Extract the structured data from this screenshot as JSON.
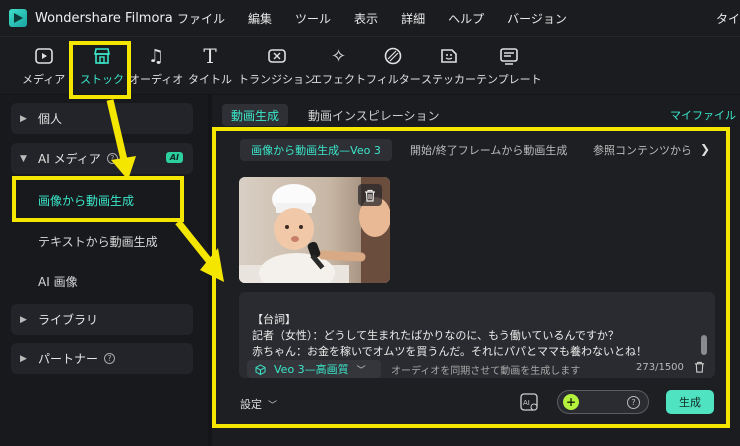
{
  "app": {
    "name": "Wondershare Filmora"
  },
  "menu": [
    "ファイル",
    "編集",
    "ツール",
    "表示",
    "詳細",
    "ヘルプ",
    "バージョン"
  ],
  "title_right_cut": "タイ",
  "toolbar": [
    {
      "label": "メディア",
      "icon": "media-icon"
    },
    {
      "label": "ストック",
      "icon": "stock-icon"
    },
    {
      "label": "オーディオ",
      "icon": "audio-icon"
    },
    {
      "label": "タイトル",
      "icon": "title-icon"
    },
    {
      "label": "トランジション",
      "icon": "transition-icon"
    },
    {
      "label": "エフェクト",
      "icon": "effect-icon"
    },
    {
      "label": "フィルター",
      "icon": "filter-icon"
    },
    {
      "label": "ステッカー",
      "icon": "sticker-icon"
    },
    {
      "label": "テンプレート",
      "icon": "template-icon"
    }
  ],
  "sidebar": {
    "personal": "個人",
    "ai_media": "AI メディア",
    "ai_badge": "AI",
    "image_to_video": "画像から動画生成",
    "text_to_video": "テキストから動画生成",
    "ai_image": "AI 画像",
    "library": "ライブラリ",
    "partner": "パートナー"
  },
  "tabs": {
    "video_gen": "動画生成",
    "inspiration": "動画インスピレーション",
    "my_files": "マイファイル"
  },
  "subtabs": [
    "画像から動画生成—Veo 3",
    "開始/終了フレームから動画生成",
    "参照コンテンツから動"
  ],
  "prompt": {
    "line1": "【台詞】",
    "line2": "記者（女性）：どうして生まれたばかりなのに、もう働いているんですか？",
    "line3": "赤ちゃん：お金を稼いでオムツを買うんだ。それにパパとママも養わないとね！",
    "model": "Veo 3—高画質",
    "sync": "オーディオを同期させて動画を生成します",
    "count": "273/1500"
  },
  "footer": {
    "settings": "設定",
    "generate": "生成"
  },
  "colors": {
    "accent": "#3be7c9",
    "highlight": "#f5e600",
    "generate_bg": "#4fe3c2"
  }
}
